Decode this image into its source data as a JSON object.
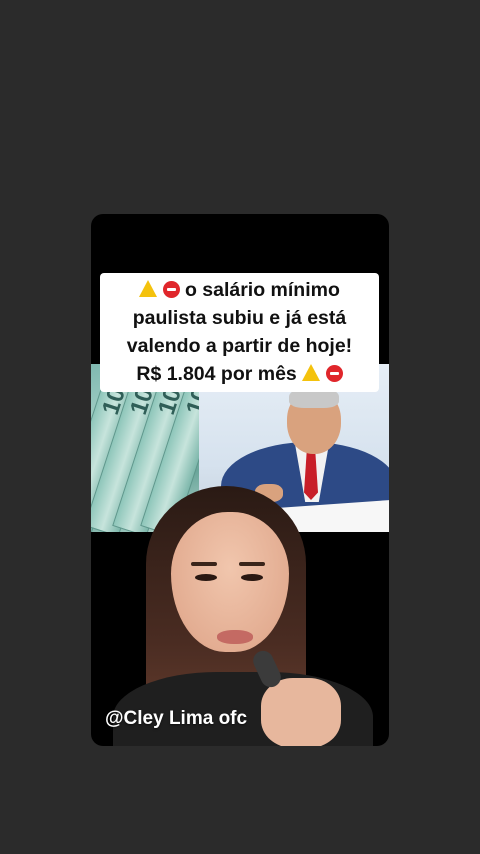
{
  "post": {
    "headline_line1": "o salário mínimo",
    "headline_line2": "paulista subiu e já está",
    "headline_line3": "valendo a partir de hoje!",
    "headline_line4": "R$ 1.804 por mês",
    "watermark": "@Cley Lima ofc",
    "money_note_value": "100"
  },
  "colors": {
    "background": "#2b2b2b",
    "headline_bg": "#ffffff",
    "warning": "#f4c20d",
    "stop": "#e0262b"
  },
  "icons": [
    "warning-icon",
    "stop-sign-icon"
  ]
}
